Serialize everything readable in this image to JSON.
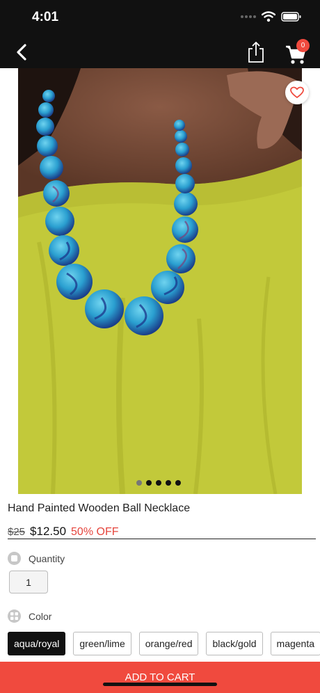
{
  "status_bar": {
    "time": "4:01"
  },
  "nav": {
    "cart_count": "0"
  },
  "product": {
    "title": "Hand Painted Wooden Ball Necklace",
    "price_original": "$25",
    "price_sale": "$12.50",
    "discount": "50% OFF",
    "image_pages": 5,
    "image_current_page": 1
  },
  "quantity": {
    "label": "Quantity",
    "value": "1"
  },
  "color": {
    "label": "Color",
    "options": [
      "aqua/royal",
      "green/lime",
      "orange/red",
      "black/gold",
      "magenta"
    ],
    "selected": "aqua/royal"
  },
  "cta": {
    "add_to_cart": "ADD TO CART"
  },
  "colors": {
    "accent": "#f04a3e",
    "dark": "#111111",
    "shirt": "#c2c93a",
    "bead": "#2a9fd0"
  }
}
